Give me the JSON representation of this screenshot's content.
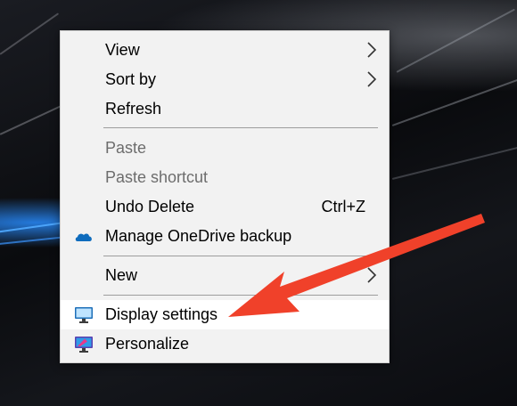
{
  "menu": {
    "items": [
      {
        "label": "View",
        "submenu": true
      },
      {
        "label": "Sort by",
        "submenu": true
      },
      {
        "label": "Refresh"
      },
      {
        "label": "Paste",
        "disabled": true
      },
      {
        "label": "Paste shortcut",
        "disabled": true
      },
      {
        "label": "Undo Delete",
        "shortcut": "Ctrl+Z"
      },
      {
        "label": "Manage OneDrive backup",
        "icon": "onedrive-cloud-icon"
      },
      {
        "label": "New",
        "submenu": true
      },
      {
        "label": "Display settings",
        "icon": "monitor-icon",
        "highlighted": true
      },
      {
        "label": "Personalize",
        "icon": "personalize-monitor-icon"
      }
    ]
  },
  "colors": {
    "menu_background": "#f2f2f2",
    "highlight": "#ffffff",
    "disabled_text": "#6d6d6d",
    "annotation_arrow": "#f0412a",
    "onedrive_blue": "#0f6cbd"
  },
  "annotation": {
    "type": "arrow",
    "points_to": "Display settings"
  }
}
